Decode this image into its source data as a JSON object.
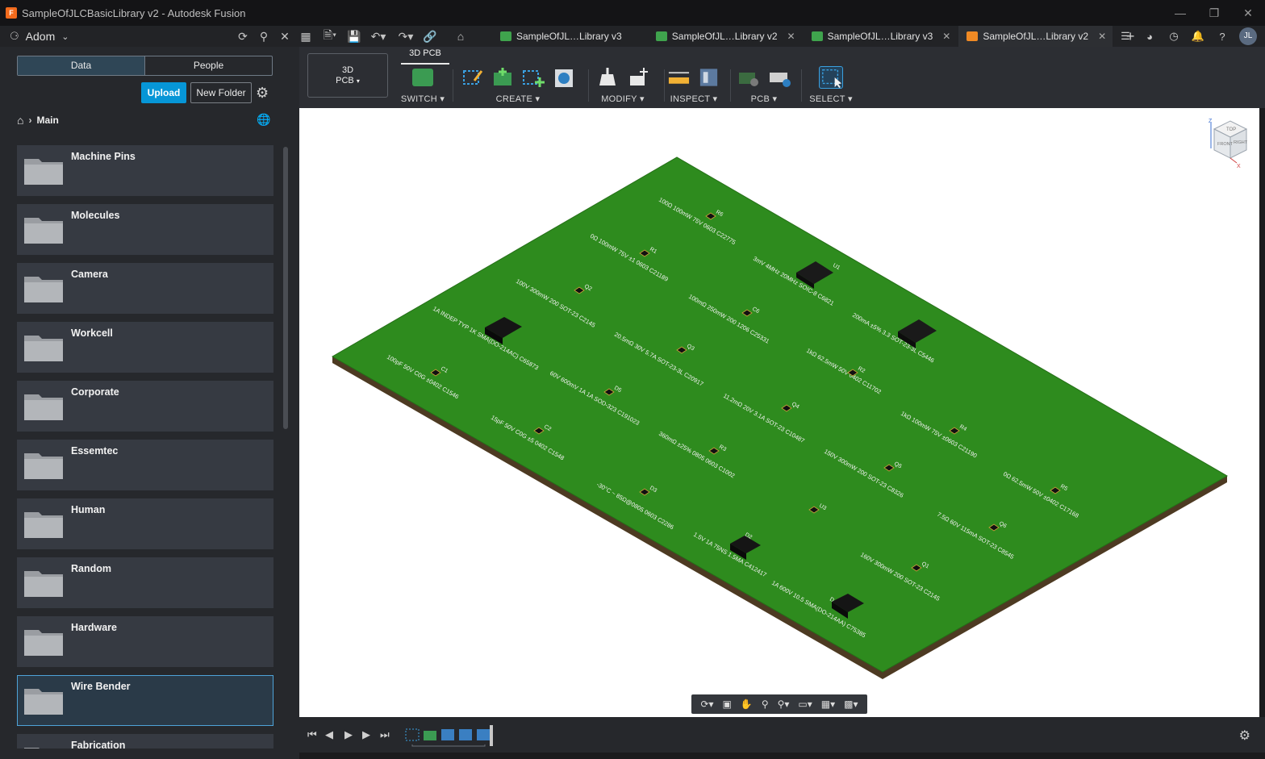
{
  "window": {
    "title": "SampleOfJLCBasicLibrary v2 - Autodesk Fusion",
    "app_icon_letter": "F"
  },
  "topbar": {
    "team_name": "Adom",
    "tabs": [
      {
        "label": "SampleOfJL…Library v3",
        "color": "#3fa34d"
      },
      {
        "label": "SampleOfJL…Library v2",
        "color": "#3fa34d"
      },
      {
        "label": "SampleOfJL…Library v3",
        "color": "#3fa34d"
      },
      {
        "label": "SampleOfJL…Library v2",
        "color": "#f08a24",
        "active": true
      }
    ],
    "user_initials": "JL"
  },
  "panel": {
    "tabs": {
      "data": "Data",
      "people": "People"
    },
    "upload_label": "Upload",
    "new_folder_label": "New Folder",
    "breadcrumb": "Main",
    "folders": [
      {
        "name": "Machine Pins"
      },
      {
        "name": "Molecules"
      },
      {
        "name": "Camera"
      },
      {
        "name": "Workcell"
      },
      {
        "name": "Corporate"
      },
      {
        "name": "Essemtec"
      },
      {
        "name": "Human"
      },
      {
        "name": "Random"
      },
      {
        "name": "Hardware"
      },
      {
        "name": "Wire Bender",
        "selected": true
      },
      {
        "name": "Fabrication"
      }
    ]
  },
  "toolbar": {
    "workspace_label_1": "3D",
    "workspace_label_2": "PCB",
    "active_tab": "3D PCB",
    "groups": {
      "switch": "SWITCH",
      "create": "CREATE",
      "modify": "MODIFY",
      "inspect": "INSPECT",
      "pcb": "PCB",
      "select": "SELECT"
    }
  },
  "viewcube": {
    "top": "TOP",
    "front": "FRONT",
    "right": "RIGHT",
    "axis_z": "Z",
    "axis_x": "X"
  },
  "board": {
    "color": "#2e8b1e",
    "labels": [
      {
        "ref": "R6",
        "text": "100Ω 100mW 75V 0603 C22775"
      },
      {
        "ref": "R1",
        "text": "0Ω 100mW 75V ±1 0603 C21189"
      },
      {
        "ref": "U1",
        "text": "3mV 4MHz 20MHz SOIC-8 C6821"
      },
      {
        "ref": "Q2",
        "text": "100V 300mW 200 SOT-23 C2145"
      },
      {
        "ref": "C6",
        "text": "100mΩ 250mW 200 1206 C25331"
      },
      {
        "ref": "U2",
        "text": "200mA ±5% 3.3 SOT-23-3L C5446"
      },
      {
        "ref": "D1",
        "text": "1A INDEP TYP 1K SMA(DO-214AC) C65873"
      },
      {
        "ref": "Q3",
        "text": "20.5mΩ 30V 5.7A SOT-23-3L C20917"
      },
      {
        "ref": "R2",
        "text": "1kΩ 62.5mW 50V 0402 C11702"
      },
      {
        "ref": "C1",
        "text": "100pF 50V C0G ±0402 C1546"
      },
      {
        "ref": "D5",
        "text": "60V 600mV 1A 1A SOD-323 C191023"
      },
      {
        "ref": "Q4",
        "text": "11.2mΩ 20V 3.1A SOT-23 C10487"
      },
      {
        "ref": "R4",
        "text": "1kΩ 100mW 75V ±0603 C21190"
      },
      {
        "ref": "C2",
        "text": "15pF 50V C0G ±5 0402 C1548"
      },
      {
        "ref": "R3",
        "text": "360mΩ ±25% 0805 0603 C1002"
      },
      {
        "ref": "Q5",
        "text": "150V 300mW 200 SOT-23 C8326"
      },
      {
        "ref": "R5",
        "text": "0Ω 62.5mW 50V ±0402 C17168"
      },
      {
        "ref": "D3",
        "text": "-30°C ~ 85Ω@0805 0603 C2286"
      },
      {
        "ref": "U3",
        "text": ""
      },
      {
        "ref": "Q6",
        "text": "7.5Ω 60V 115mA SOT-23 C8545"
      },
      {
        "ref": "D2",
        "text": "1.5V 1A 75NS 1.5MA C412417"
      },
      {
        "ref": "D4",
        "text": "1A 600V 10.5 SMA(DO-214AA) C75385"
      },
      {
        "ref": "Q1",
        "text": "160V 300mW 200 SOT-23 C2145"
      }
    ]
  }
}
